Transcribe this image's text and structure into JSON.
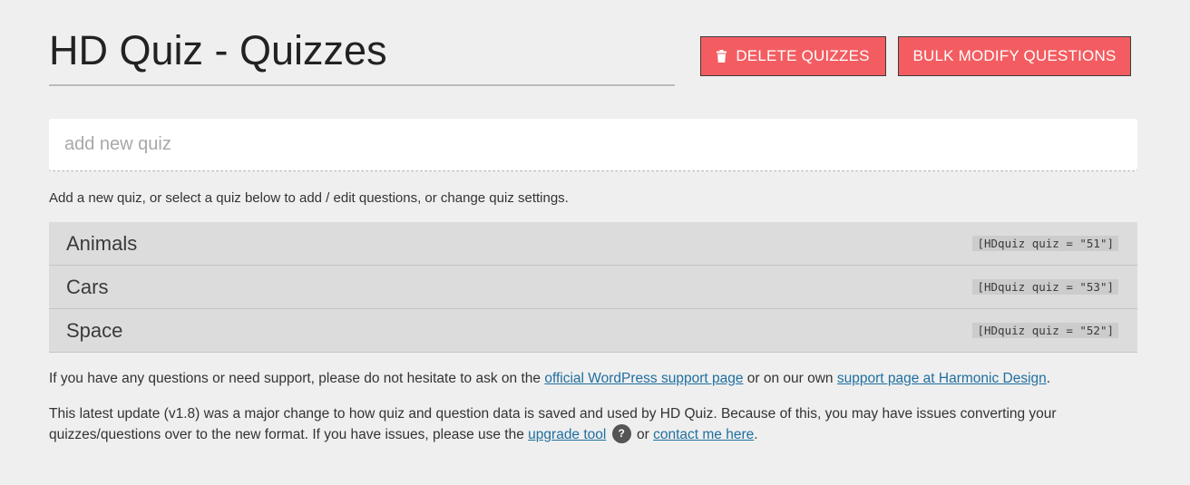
{
  "header": {
    "title": "HD Quiz - Quizzes",
    "delete_label": "DELETE QUIZZES",
    "bulk_label": "BULK MODIFY QUESTIONS"
  },
  "new_quiz": {
    "placeholder": "add new quiz",
    "helper": "Add a new quiz, or select a quiz below to add / edit questions, or change quiz settings."
  },
  "quizzes": [
    {
      "name": "Animals",
      "shortcode": "[HDquiz quiz = \"51\"]"
    },
    {
      "name": "Cars",
      "shortcode": "[HDquiz quiz = \"53\"]"
    },
    {
      "name": "Space",
      "shortcode": "[HDquiz quiz = \"52\"]"
    }
  ],
  "support": {
    "text1": "If you have any questions or need support, please do not hesitate to ask on the ",
    "link1": "official WordPress support page",
    "text2": " or on our own ",
    "link2": "support page at Harmonic Design",
    "text3": "."
  },
  "update": {
    "text1": "This latest update (v1.8) was a major change to how quiz and question data is saved and used by HD Quiz. Because of this, you may have issues converting your quizzes/questions over to the new format. If you have issues, please use the ",
    "link1": "upgrade tool",
    "help_glyph": "?",
    "text2": " or ",
    "link2": "contact me here",
    "text3": "."
  },
  "colors": {
    "button_bg": "#f35d61",
    "link": "#1f6fa0",
    "row_bg": "#dcdcdc",
    "page_bg": "#efefef"
  },
  "icons": {
    "delete_button": "trash-icon",
    "upgrade_help": "question-circle-icon"
  }
}
